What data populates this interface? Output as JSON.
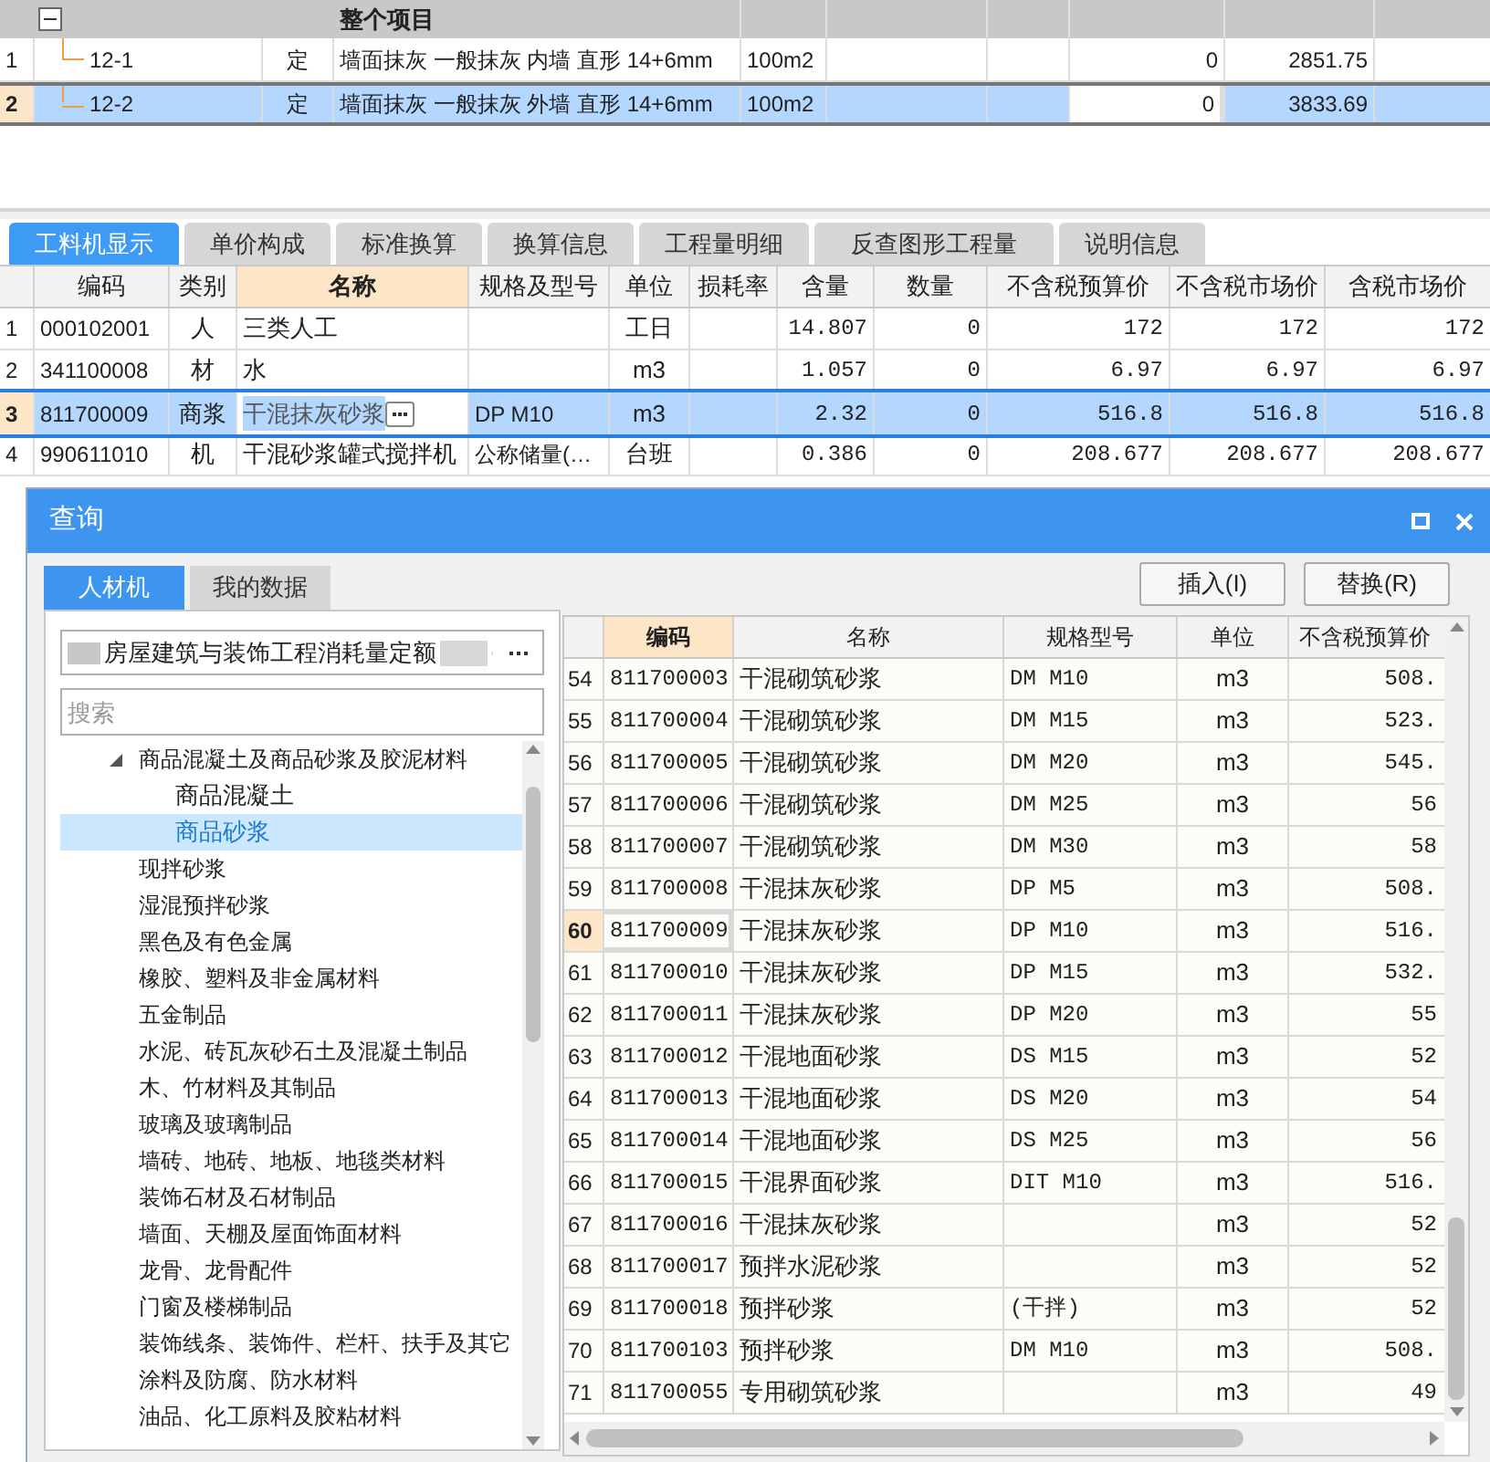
{
  "top_grid": {
    "group_title": "整个项目",
    "expanded": true,
    "rows": [
      {
        "num": "1",
        "code": "12-1",
        "type": "定",
        "name": "墙面抹灰 一般抹灰 内墙 直形 14+6mm",
        "unit": "100m2",
        "qty": "0",
        "price": "2851.75",
        "selected": false
      },
      {
        "num": "2",
        "code": "12-2",
        "type": "定",
        "name": "墙面抹灰 一般抹灰 外墙 直形 14+6mm",
        "unit": "100m2",
        "qty": "0",
        "price": "3833.69",
        "selected": true
      }
    ]
  },
  "tabs": [
    {
      "label": "工料机显示",
      "selected": true
    },
    {
      "label": "单价构成",
      "selected": false
    },
    {
      "label": "标准换算",
      "selected": false
    },
    {
      "label": "换算信息",
      "selected": false
    },
    {
      "label": "工程量明细",
      "selected": false
    },
    {
      "label": "反查图形工程量",
      "selected": false
    },
    {
      "label": "说明信息",
      "selected": false
    }
  ],
  "material_table": {
    "columns": [
      "编码",
      "类别",
      "名称",
      "规格及型号",
      "单位",
      "损耗率",
      "含量",
      "数量",
      "不含税预算价",
      "不含税市场价",
      "含税市场价"
    ],
    "rows": [
      {
        "num": "1",
        "cells": [
          "000102001",
          "人",
          "三类人工",
          "",
          "工日",
          "",
          "14.807",
          "0",
          "172",
          "172",
          "172"
        ],
        "selected": false
      },
      {
        "num": "2",
        "cells": [
          "341100008",
          "材",
          "水",
          "",
          "m3",
          "",
          "1.057",
          "0",
          "6.97",
          "6.97",
          "6.97"
        ],
        "selected": false
      },
      {
        "num": "3",
        "cells": [
          "811700009",
          "商浆",
          "干混抹灰砂浆",
          "DP M10",
          "m3",
          "",
          "2.32",
          "0",
          "516.8",
          "516.8",
          "516.8"
        ],
        "selected": true
      },
      {
        "num": "4",
        "cells": [
          "990611010",
          "机",
          "干混砂浆罐式搅拌机",
          "公称储量(…",
          "台班",
          "",
          "0.386",
          "0",
          "208.677",
          "208.677",
          "208.677"
        ],
        "selected": false
      }
    ]
  },
  "dialog": {
    "title": "查询",
    "tabs": [
      {
        "label": "人材机",
        "selected": true
      },
      {
        "label": "我的数据",
        "selected": false
      }
    ],
    "library": "房屋建筑与装饰工程消耗量定额",
    "search": {
      "placeholder": "搜索"
    },
    "tree": [
      {
        "label": "商品混凝土及商品砂浆及胶泥材料",
        "expanded": true,
        "selected": false,
        "children": [
          {
            "label": "商品混凝土",
            "selected": false
          },
          {
            "label": "商品砂浆",
            "selected": true
          }
        ]
      },
      {
        "label": "现拌砂浆",
        "selected": false
      },
      {
        "label": "湿混预拌砂浆",
        "selected": false
      },
      {
        "label": "黑色及有色金属",
        "selected": false
      },
      {
        "label": "橡胶、塑料及非金属材料",
        "selected": false
      },
      {
        "label": "五金制品",
        "selected": false
      },
      {
        "label": "水泥、砖瓦灰砂石土及混凝土制品",
        "selected": false
      },
      {
        "label": "木、竹材料及其制品",
        "selected": false
      },
      {
        "label": "玻璃及玻璃制品",
        "selected": false
      },
      {
        "label": "墙砖、地砖、地板、地毯类材料",
        "selected": false
      },
      {
        "label": "装饰石材及石材制品",
        "selected": false
      },
      {
        "label": "墙面、天棚及屋面饰面材料",
        "selected": false
      },
      {
        "label": "龙骨、龙骨配件",
        "selected": false
      },
      {
        "label": "门窗及楼梯制品",
        "selected": false
      },
      {
        "label": "装饰线条、装饰件、栏杆、扶手及其它",
        "selected": false
      },
      {
        "label": "涂料及防腐、防水材料",
        "selected": false
      },
      {
        "label": "油品、化工原料及胶粘材料",
        "selected": false
      }
    ],
    "buttons": [
      "插入(I)",
      "替换(R)"
    ],
    "grid": {
      "columns": [
        "编码",
        "名称",
        "规格型号",
        "单位",
        "不含税预算价"
      ],
      "rows": [
        {
          "num": "54",
          "cells": [
            "811700003",
            "干混砌筑砂浆",
            "DM M10",
            "m3",
            "508."
          ],
          "selected": false
        },
        {
          "num": "55",
          "cells": [
            "811700004",
            "干混砌筑砂浆",
            "DM M15",
            "m3",
            "523."
          ],
          "selected": false
        },
        {
          "num": "56",
          "cells": [
            "811700005",
            "干混砌筑砂浆",
            "DM M20",
            "m3",
            "545."
          ],
          "selected": false
        },
        {
          "num": "57",
          "cells": [
            "811700006",
            "干混砌筑砂浆",
            "DM M25",
            "m3",
            "56"
          ],
          "selected": false
        },
        {
          "num": "58",
          "cells": [
            "811700007",
            "干混砌筑砂浆",
            "DM M30",
            "m3",
            "58"
          ],
          "selected": false
        },
        {
          "num": "59",
          "cells": [
            "811700008",
            "干混抹灰砂浆",
            "DP M5",
            "m3",
            "508."
          ],
          "selected": false
        },
        {
          "num": "60",
          "cells": [
            "811700009",
            "干混抹灰砂浆",
            "DP M10",
            "m3",
            "516."
          ],
          "selected": true
        },
        {
          "num": "61",
          "cells": [
            "811700010",
            "干混抹灰砂浆",
            "DP M15",
            "m3",
            "532."
          ],
          "selected": false
        },
        {
          "num": "62",
          "cells": [
            "811700011",
            "干混抹灰砂浆",
            "DP M20",
            "m3",
            "55"
          ],
          "selected": false
        },
        {
          "num": "63",
          "cells": [
            "811700012",
            "干混地面砂浆",
            "DS M15",
            "m3",
            "52"
          ],
          "selected": false
        },
        {
          "num": "64",
          "cells": [
            "811700013",
            "干混地面砂浆",
            "DS M20",
            "m3",
            "54"
          ],
          "selected": false
        },
        {
          "num": "65",
          "cells": [
            "811700014",
            "干混地面砂浆",
            "DS M25",
            "m3",
            "56"
          ],
          "selected": false
        },
        {
          "num": "66",
          "cells": [
            "811700015",
            "干混界面砂浆",
            "DIT M10",
            "m3",
            "516."
          ],
          "selected": false
        },
        {
          "num": "67",
          "cells": [
            "811700016",
            "干混抹灰砂浆",
            "",
            "m3",
            "52"
          ],
          "selected": false
        },
        {
          "num": "68",
          "cells": [
            "811700017",
            "预拌水泥砂浆",
            "",
            "m3",
            "52"
          ],
          "selected": false
        },
        {
          "num": "69",
          "cells": [
            "811700018",
            "预拌砂浆",
            "(干拌)",
            "m3",
            "52"
          ],
          "selected": false
        },
        {
          "num": "70",
          "cells": [
            "811700103",
            "预拌砂浆",
            "DM M10",
            "m3",
            "508."
          ],
          "selected": false
        },
        {
          "num": "71",
          "cells": [
            "811700055",
            "专用砌筑砂浆",
            "",
            "m3",
            "49"
          ],
          "selected": false
        }
      ]
    }
  }
}
